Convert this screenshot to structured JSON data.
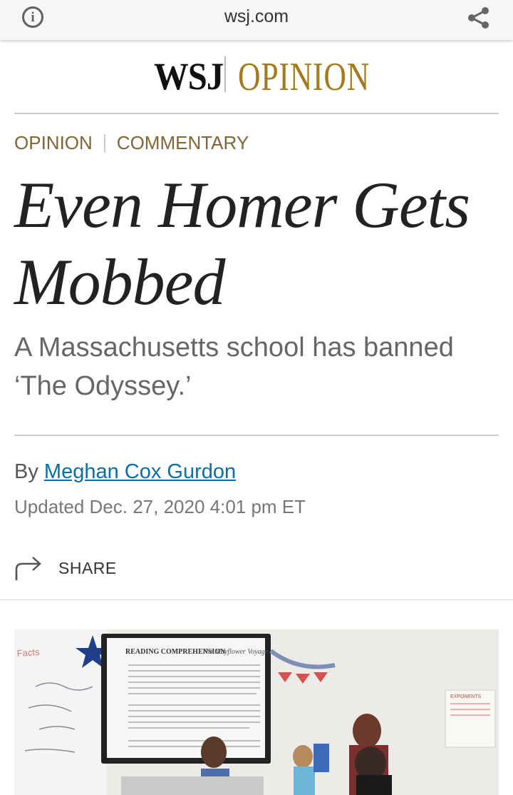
{
  "browser": {
    "domain": "wsj.com",
    "info_icon": "info-icon",
    "share_icon": "share-nodes-icon"
  },
  "masthead": {
    "brand": "WSJ",
    "section": "OPINION",
    "section_color": "#a37a1e"
  },
  "flashline": {
    "section": "OPINION",
    "subsection": "COMMENTARY"
  },
  "article": {
    "headline": "Even Homer Gets Mobbed",
    "dek": "A Massachusetts school has banned ‘The Odyssey.’",
    "byline_prefix": "By ",
    "author": "Meghan Cox Gurdon",
    "timestamp": "Updated Dec. 27, 2020 4:01 pm ET",
    "share_label": "SHARE",
    "share_icon": "share-arrow-icon",
    "link_color": "#0a6f9f"
  },
  "photo": {
    "screen_title": "READING COMPREHENSION",
    "screen_subtitle": "The Mayflower Voyage",
    "whiteboard_note": "EXPONENTS"
  }
}
